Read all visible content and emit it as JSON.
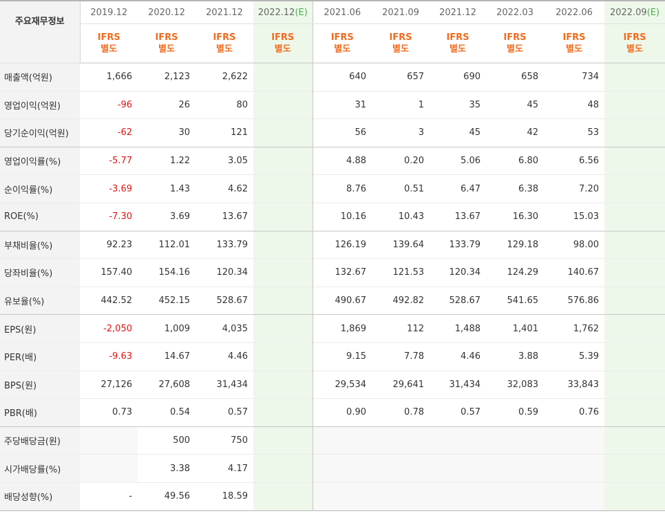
{
  "title": "주요재무정보",
  "ifrs_top": "IFRS",
  "ifrs_bottom": "별도",
  "est_mark": "(E)",
  "columns": [
    {
      "period": "2019.12",
      "est": false
    },
    {
      "period": "2020.12",
      "est": false
    },
    {
      "period": "2021.12",
      "est": false
    },
    {
      "period": "2022.12",
      "est": true
    },
    {
      "period": "2021.06",
      "est": false
    },
    {
      "period": "2021.09",
      "est": false
    },
    {
      "period": "2021.12",
      "est": false
    },
    {
      "period": "2022.03",
      "est": false
    },
    {
      "period": "2022.06",
      "est": false
    },
    {
      "period": "2022.09",
      "est": true
    }
  ],
  "rows": [
    {
      "label": "매출액(억원)",
      "group_start": true,
      "values": [
        "1,666",
        "2,123",
        "2,622",
        "",
        "640",
        "657",
        "690",
        "658",
        "734",
        ""
      ]
    },
    {
      "label": "영업이익(억원)",
      "group_start": false,
      "values": [
        "-96",
        "26",
        "80",
        "",
        "31",
        "1",
        "35",
        "45",
        "48",
        ""
      ]
    },
    {
      "label": "당기순이익(억원)",
      "group_start": false,
      "values": [
        "-62",
        "30",
        "121",
        "",
        "56",
        "3",
        "45",
        "42",
        "53",
        ""
      ]
    },
    {
      "label": "영업이익률(%)",
      "group_start": true,
      "values": [
        "-5.77",
        "1.22",
        "3.05",
        "",
        "4.88",
        "0.20",
        "5.06",
        "6.80",
        "6.56",
        ""
      ]
    },
    {
      "label": "순이익률(%)",
      "group_start": false,
      "values": [
        "-3.69",
        "1.43",
        "4.62",
        "",
        "8.76",
        "0.51",
        "6.47",
        "6.38",
        "7.20",
        ""
      ]
    },
    {
      "label": "ROE(%)",
      "group_start": false,
      "values": [
        "-7.30",
        "3.69",
        "13.67",
        "",
        "10.16",
        "10.43",
        "13.67",
        "16.30",
        "15.03",
        ""
      ]
    },
    {
      "label": "부채비율(%)",
      "group_start": true,
      "values": [
        "92.23",
        "112.01",
        "133.79",
        "",
        "126.19",
        "139.64",
        "133.79",
        "129.18",
        "98.00",
        ""
      ]
    },
    {
      "label": "당좌비율(%)",
      "group_start": false,
      "values": [
        "157.40",
        "154.16",
        "120.34",
        "",
        "132.67",
        "121.53",
        "120.34",
        "124.29",
        "140.67",
        ""
      ]
    },
    {
      "label": "유보율(%)",
      "group_start": false,
      "values": [
        "442.52",
        "452.15",
        "528.67",
        "",
        "490.67",
        "492.82",
        "528.67",
        "541.65",
        "576.86",
        ""
      ]
    },
    {
      "label": "EPS(원)",
      "group_start": true,
      "values": [
        "-2,050",
        "1,009",
        "4,035",
        "",
        "1,869",
        "112",
        "1,488",
        "1,401",
        "1,762",
        ""
      ]
    },
    {
      "label": "PER(배)",
      "group_start": false,
      "values": [
        "-9.63",
        "14.67",
        "4.46",
        "",
        "9.15",
        "7.78",
        "4.46",
        "3.88",
        "5.39",
        ""
      ]
    },
    {
      "label": "BPS(원)",
      "group_start": false,
      "values": [
        "27,126",
        "27,608",
        "31,434",
        "",
        "29,534",
        "29,641",
        "31,434",
        "32,083",
        "33,843",
        ""
      ]
    },
    {
      "label": "PBR(배)",
      "group_start": false,
      "values": [
        "0.73",
        "0.54",
        "0.57",
        "",
        "0.90",
        "0.78",
        "0.57",
        "0.59",
        "0.76",
        ""
      ]
    },
    {
      "label": "주당배당금(원)",
      "group_start": true,
      "blank_annual_first": true,
      "values": [
        "",
        "500",
        "750",
        "",
        "",
        "",
        "",
        "",
        "",
        ""
      ]
    },
    {
      "label": "시가배당률(%)",
      "group_start": false,
      "blank_annual_first": true,
      "values": [
        "",
        "3.38",
        "4.17",
        "",
        "",
        "",
        "",
        "",
        "",
        ""
      ]
    },
    {
      "label": "배당성향(%)",
      "group_start": false,
      "values": [
        "-",
        "49.56",
        "18.59",
        "",
        "",
        "",
        "",
        "",
        "",
        ""
      ]
    }
  ]
}
